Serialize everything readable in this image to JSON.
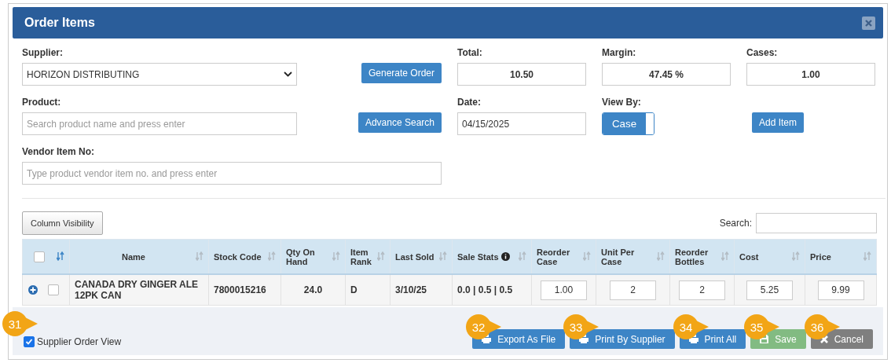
{
  "window": {
    "title": "Order Items"
  },
  "form": {
    "supplier": {
      "label": "Supplier:",
      "value": "HORIZON DISTRIBUTING"
    },
    "generate_button": "Generate Order",
    "total": {
      "label": "Total:",
      "value": "10.50"
    },
    "margin": {
      "label": "Margin:",
      "value": "47.45 %"
    },
    "cases": {
      "label": "Cases:",
      "value": "1.00"
    },
    "product": {
      "label": "Product:",
      "placeholder": "Search product name and press enter"
    },
    "advance_button": "Advance Search",
    "date": {
      "label": "Date:",
      "value": "04/15/2025"
    },
    "view_by": {
      "label": "View By:",
      "value": "Case",
      "on": true
    },
    "add_button": "Add Item",
    "vendor_item": {
      "label": "Vendor Item No:",
      "placeholder": "Type product vendor item no. and press enter"
    }
  },
  "column_visibility_button": "Column Visibility",
  "search": {
    "label": "Search:"
  },
  "table": {
    "columns": [
      {
        "kind": "select",
        "checked": false,
        "sorted": true
      },
      {
        "label": "Name",
        "sorted": false
      },
      {
        "label": "Stock Code",
        "sorted": false
      },
      {
        "label": "Qty On Hand",
        "sorted": false
      },
      {
        "label": "Item Rank",
        "sorted": false
      },
      {
        "label": "Last Sold",
        "sorted": false
      },
      {
        "label": "Sale Stats",
        "sorted": false,
        "info": true
      },
      {
        "label": "Reorder Case",
        "sorted": false
      },
      {
        "label": "Unit Per Case",
        "sorted": false
      },
      {
        "label": "Reorder Bottles",
        "sorted": false
      },
      {
        "label": "Cost",
        "sorted": false
      },
      {
        "label": "Price",
        "sorted": false
      }
    ],
    "rows": [
      {
        "cells": [
          {
            "kind": "select",
            "checked": false
          },
          {
            "kind": "text",
            "value": "CANADA DRY GINGER ALE 12PK CAN"
          },
          {
            "kind": "text",
            "value": "7800015216"
          },
          {
            "kind": "center",
            "value": "24.0"
          },
          {
            "kind": "text",
            "value": "D"
          },
          {
            "kind": "text",
            "value": "3/10/25"
          },
          {
            "kind": "text",
            "value": "0.0 | 0.5 | 0.5"
          },
          {
            "kind": "input",
            "value": "1.00"
          },
          {
            "kind": "input",
            "value": "2"
          },
          {
            "kind": "input",
            "value": "2"
          },
          {
            "kind": "input",
            "value": "5.25"
          },
          {
            "kind": "input",
            "value": "9.99"
          }
        ]
      }
    ]
  },
  "footer": {
    "supplier_order_view": {
      "label": "Supplier Order View",
      "checked": true,
      "callout": "31"
    },
    "buttons": [
      {
        "label": "Export As File",
        "kind": "primary",
        "callout": "32"
      },
      {
        "label": "Print By Supplier",
        "kind": "primary",
        "callout": "33"
      },
      {
        "label": "Print All",
        "kind": "primary",
        "callout": "34"
      },
      {
        "label": "Save",
        "kind": "success",
        "callout": "35"
      },
      {
        "label": "Cancel",
        "kind": "default",
        "callout": "36"
      }
    ]
  }
}
